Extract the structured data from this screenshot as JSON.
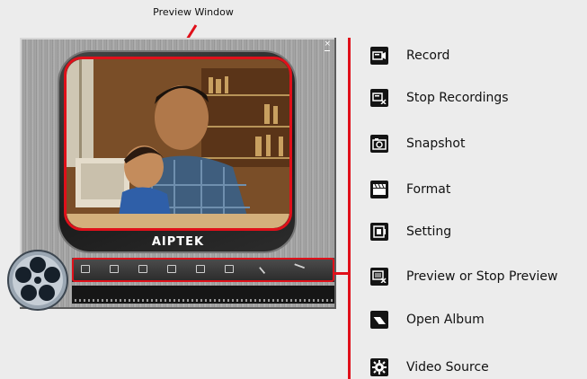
{
  "callout": {
    "label": "Preview Window"
  },
  "window": {
    "close_glyph": "×",
    "brand": "AIPTEK"
  },
  "controls": [
    {
      "icon": "record-icon"
    },
    {
      "icon": "stop-recordings-icon"
    },
    {
      "icon": "snapshot-icon"
    },
    {
      "icon": "format-icon"
    },
    {
      "icon": "setting-icon"
    },
    {
      "icon": "preview-icon"
    },
    {
      "icon": "open-album-icon"
    },
    {
      "icon": "video-source-icon"
    }
  ],
  "legend": [
    {
      "label": "Record",
      "icon": "record-icon"
    },
    {
      "label": "Stop Recordings",
      "icon": "stop-recordings-icon"
    },
    {
      "label": "Snapshot",
      "icon": "snapshot-icon"
    },
    {
      "label": "Format",
      "icon": "format-icon"
    },
    {
      "label": "Setting",
      "icon": "setting-icon"
    },
    {
      "label": "Preview or Stop Preview",
      "icon": "preview-icon"
    },
    {
      "label": "Open Album",
      "icon": "open-album-icon"
    },
    {
      "label": "Video Source",
      "icon": "video-source-icon"
    }
  ],
  "colors": {
    "highlight": "#e0101a",
    "icon_bg": "#141414"
  }
}
